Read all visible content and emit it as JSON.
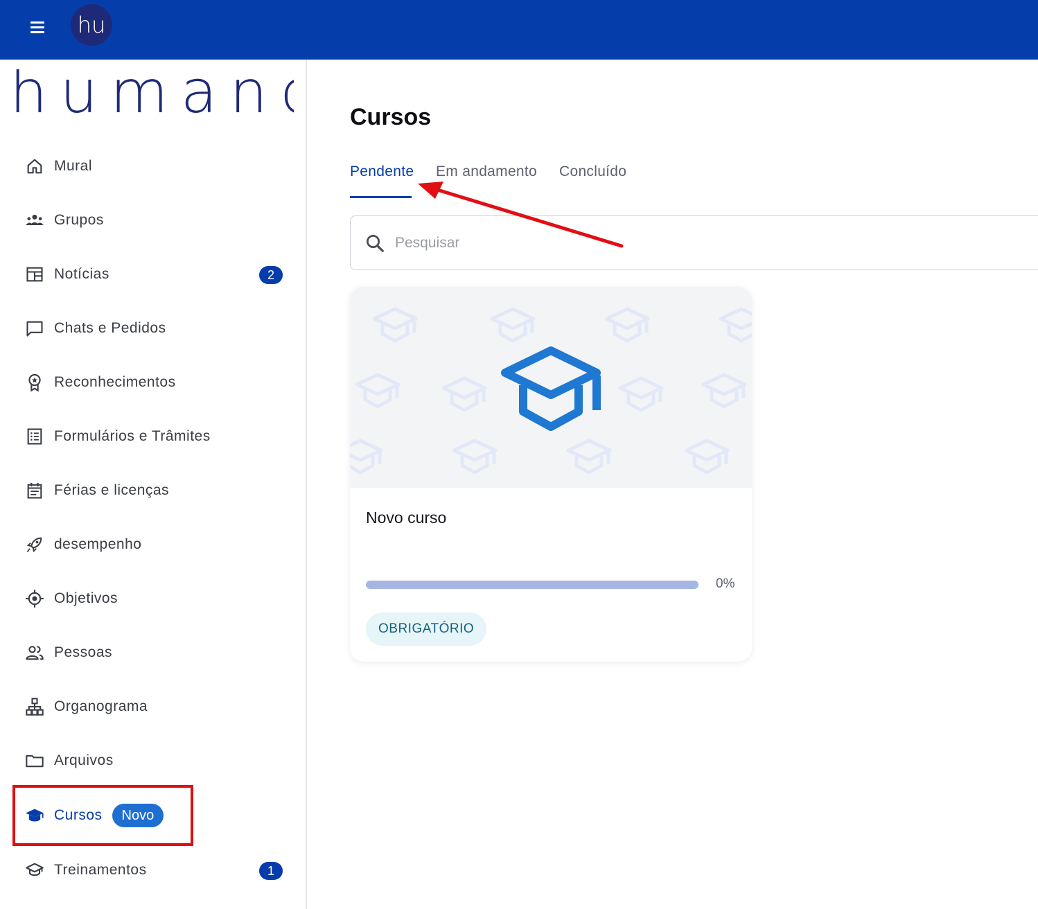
{
  "topbar": {
    "avatar_initials": "hu",
    "color": "#053dab"
  },
  "logo": {
    "text": "humand",
    "color": "#1e2a78"
  },
  "sidebar": {
    "items": [
      {
        "label": "Mural",
        "icon": "home-icon"
      },
      {
        "label": "Grupos",
        "icon": "groups-icon"
      },
      {
        "label": "Notícias",
        "icon": "newspaper-icon",
        "count": "2"
      },
      {
        "label": "Chats e Pedidos",
        "icon": "chat-icon"
      },
      {
        "label": "Reconhecimentos",
        "icon": "award-icon"
      },
      {
        "label": "Formulários e Trâmites",
        "icon": "form-icon"
      },
      {
        "label": "Férias e licenças",
        "icon": "calendar-icon"
      },
      {
        "label": "desempenho",
        "icon": "rocket-icon"
      },
      {
        "label": "Objetivos",
        "icon": "target-icon"
      },
      {
        "label": "Pessoas",
        "icon": "people-icon"
      },
      {
        "label": "Organograma",
        "icon": "org-chart-icon"
      },
      {
        "label": "Arquivos",
        "icon": "folder-icon"
      },
      {
        "label": "Cursos",
        "icon": "graduation-cap-icon",
        "badge": "Novo",
        "active": true
      },
      {
        "label": "Treinamentos",
        "icon": "graduation-cap-outline-icon",
        "count": "1"
      }
    ]
  },
  "main": {
    "title": "Cursos",
    "tabs": [
      {
        "label": "Pendente",
        "active": true
      },
      {
        "label": "Em andamento"
      },
      {
        "label": "Concluído"
      }
    ],
    "search": {
      "placeholder": "Pesquisar",
      "value": ""
    },
    "courses": [
      {
        "title": "Novo curso",
        "progress": 0,
        "progress_label": "0%",
        "tag": "OBRIGATÓRIO"
      }
    ]
  },
  "colors": {
    "accent": "#053dab",
    "annotation": "#e10f14",
    "course_icon": "#1f78d1"
  }
}
